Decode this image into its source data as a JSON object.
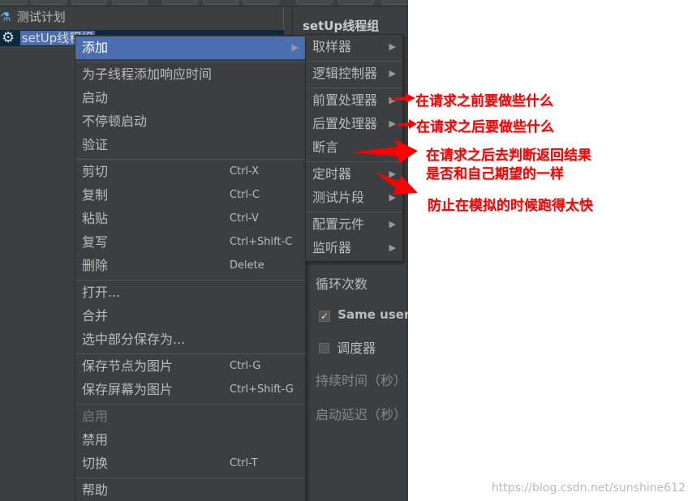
{
  "tree": {
    "items": [
      {
        "label": "测试计划",
        "icon": "flask-icon"
      },
      {
        "label": "setUp线程组",
        "icon": "gear-icon",
        "selected": true
      }
    ]
  },
  "panel": {
    "title": "setUp线程组",
    "loop_label": "循环次数",
    "same_user_label": "Same user o",
    "same_user_checked": true,
    "scheduler_label": "调度器",
    "scheduler_checked": false,
    "duration_label": "持续时间（秒）",
    "delay_label": "启动延迟（秒）"
  },
  "context_menu": {
    "items": [
      {
        "label": "添加",
        "submenu": true,
        "highlighted": true
      },
      {
        "sep": true
      },
      {
        "label": "为子线程添加响应时间"
      },
      {
        "label": "启动"
      },
      {
        "label": "不停顿启动"
      },
      {
        "label": "验证"
      },
      {
        "sep": true
      },
      {
        "label": "剪切",
        "shortcut": "Ctrl-X"
      },
      {
        "label": "复制",
        "shortcut": "Ctrl-C"
      },
      {
        "label": "粘贴",
        "shortcut": "Ctrl-V"
      },
      {
        "label": "复写",
        "shortcut": "Ctrl+Shift-C"
      },
      {
        "label": "删除",
        "shortcut": "Delete"
      },
      {
        "sep": true
      },
      {
        "label": "打开..."
      },
      {
        "label": "合并"
      },
      {
        "label": "选中部分保存为..."
      },
      {
        "sep": true
      },
      {
        "label": "保存节点为图片",
        "shortcut": "Ctrl-G"
      },
      {
        "label": "保存屏幕为图片",
        "shortcut": "Ctrl+Shift-G"
      },
      {
        "sep": true
      },
      {
        "label": "启用",
        "disabled": true
      },
      {
        "label": "禁用"
      },
      {
        "label": "切换",
        "shortcut": "Ctrl-T"
      },
      {
        "sep": true
      },
      {
        "label": "帮助"
      }
    ]
  },
  "submenu": {
    "items": [
      {
        "label": "取样器",
        "submenu": true
      },
      {
        "sep": true
      },
      {
        "label": "逻辑控制器",
        "submenu": true
      },
      {
        "sep": true
      },
      {
        "label": "前置处理器",
        "submenu": true
      },
      {
        "label": "后置处理器",
        "submenu": true
      },
      {
        "label": "断言"
      },
      {
        "sep": true
      },
      {
        "label": "定时器",
        "submenu": true
      },
      {
        "label": "测试片段",
        "submenu": true
      },
      {
        "sep": true
      },
      {
        "label": "配置元件",
        "submenu": true
      },
      {
        "label": "监听器",
        "submenu": true
      }
    ]
  },
  "annotations": {
    "pre": "在请求之前要做些什么",
    "post": "在请求之后要做些什么",
    "assert_line1": "在请求之后去判断返回结果",
    "assert_line2": "是否和自己期望的一样",
    "timer": "防止在模拟的时候跑得太快"
  },
  "watermark": "https://blog.csdn.net/sunshine612",
  "colors": {
    "background": "#3c3f41",
    "highlight": "#4b6eaf",
    "annotation": "#ff0000"
  }
}
